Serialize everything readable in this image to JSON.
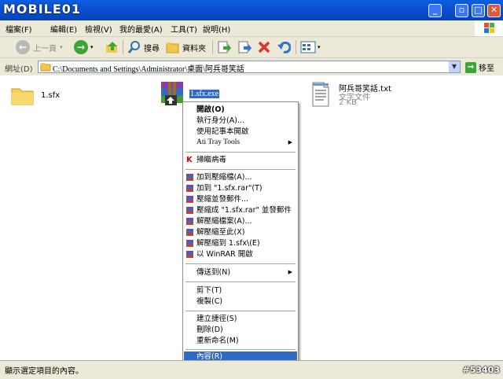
{
  "watermark": "MOBILE01",
  "titlebar": {
    "buttons": [
      "minimize",
      "maximize",
      "restore",
      "close"
    ]
  },
  "menu": [
    "檔案(F)",
    "編輯(E)",
    "檢視(V)",
    "我的最愛(A)",
    "工具(T)",
    "說明(H)"
  ],
  "toolbar": {
    "back_label": "上一頁",
    "search_label": "搜尋",
    "folders_label": "資料夾"
  },
  "address": {
    "label": "網址(D)",
    "path": "C:\\Documents and Settings\\Administrator\\桌面\\阿兵哥笑話",
    "go_label": "移至"
  },
  "files": [
    {
      "name": "1.sfx",
      "icon": "folder-icon"
    },
    {
      "name": "1.sfx.exe",
      "icon": "winrar-sfx-icon",
      "selected": true
    },
    {
      "name": "阿兵哥笑話.txt",
      "type": "文字文件",
      "size": "2 KB",
      "icon": "text-file-icon"
    }
  ],
  "context_menu": {
    "groups": [
      [
        "開啟(O)",
        "執行身分(A)...",
        "使用記事本開啟",
        "Ati Tray Tools"
      ],
      [
        "掃瞄病毒"
      ],
      [
        "加到壓縮檔(A)...",
        "加到 \"1.sfx.rar\"(T)",
        "壓縮並發郵件...",
        "壓縮成 \"1.sfx.rar\" 並發郵件",
        "解壓縮檔案(A)...",
        "解壓縮至此(X)",
        "解壓縮到 1.sfx\\(E)",
        "以 WinRAR 開啟"
      ],
      [
        "傳送到(N)"
      ],
      [
        "剪下(T)",
        "複製(C)"
      ],
      [
        "建立捷徑(S)",
        "刪除(D)",
        "重新命名(M)"
      ],
      [
        "內容(R)"
      ]
    ],
    "submenu_items": [
      "Ati Tray Tools",
      "傳送到(N)"
    ],
    "highlighted": "內容(R)"
  },
  "status": {
    "text": "顯示選定項目的內容。",
    "watermark_id": "#53403"
  },
  "colors": {
    "titlebar": "#0a4fd0",
    "selection": "#316ac5",
    "chrome": "#ece9d8"
  }
}
